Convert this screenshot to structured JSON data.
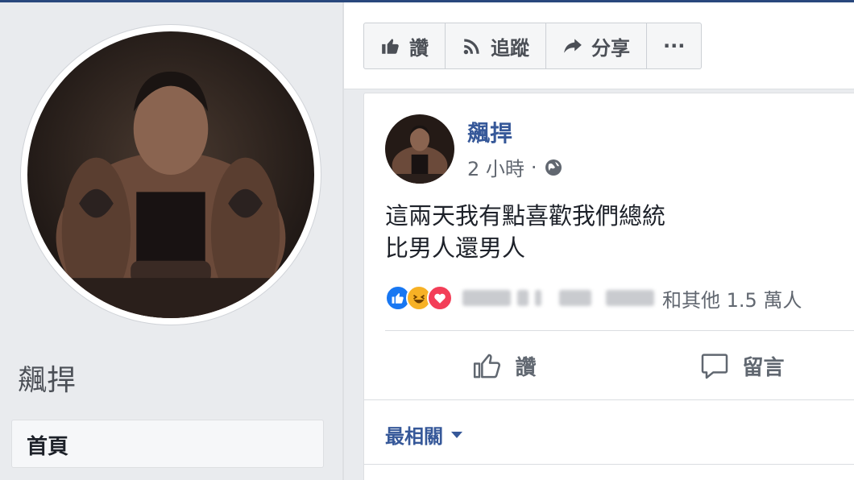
{
  "profile": {
    "name": "飆捍",
    "home_label": "首頁"
  },
  "action_bar": {
    "like_label": "讚",
    "follow_label": "追蹤",
    "share_label": "分享",
    "more_label": "···"
  },
  "post": {
    "author": "飆捍",
    "time": "2 小時",
    "dot": "·",
    "text_line1": "這兩天我有點喜歡我們總統",
    "text_line2": "比男人還男人",
    "reactions": [
      "like",
      "haha",
      "love"
    ],
    "reaction_count": "和其他 1.5 萬人",
    "like_label": "讚",
    "comment_label": "留言",
    "sort_label": "最相關"
  },
  "colors": {
    "link_blue": "#365899",
    "like_blue": "#1877f2",
    "haha_yellow": "#f7b125",
    "love_red": "#f33e58"
  },
  "icons": {
    "thumb": "thumbs-up-icon",
    "rss": "rss-icon",
    "share": "share-arrow-icon",
    "globe": "globe-icon",
    "comment": "comment-bubble-icon"
  }
}
